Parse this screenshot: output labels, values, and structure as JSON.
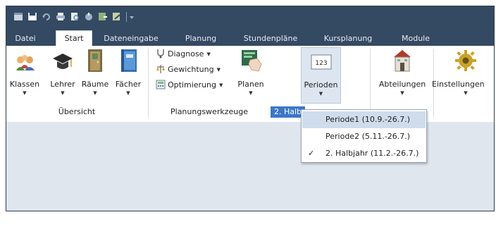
{
  "tabs": [
    {
      "label": "Datei"
    },
    {
      "label": "Start"
    },
    {
      "label": "Dateneingabe"
    },
    {
      "label": "Planung"
    },
    {
      "label": "Stundenpläne"
    },
    {
      "label": "Kursplanung"
    },
    {
      "label": "Module"
    }
  ],
  "ribbon": {
    "uebersicht": {
      "klassen": "Klassen",
      "lehrer": "Lehrer",
      "raeume": "Räume",
      "faecher": "Fächer",
      "group_label": "Übersicht"
    },
    "planungswerkzeuge": {
      "diagnose": "Diagnose",
      "gewichtung": "Gewichtung",
      "optimierung": "Optimierung",
      "planen": "Planen",
      "group_label": "Planungswerkzeuge"
    },
    "perioden": {
      "label": "Perioden",
      "icon_text": "123",
      "group_label": "2. Halb"
    },
    "abteilungen": {
      "label": "Abteilungen"
    },
    "einstellungen": {
      "label": "Einstellungen"
    }
  },
  "perioden_menu": {
    "items": [
      {
        "label": "Periode1 (10.9.-26.7.)",
        "checked": false
      },
      {
        "label": "Periode2 (5.11.-26.7.)",
        "checked": false
      },
      {
        "label": "2. Halbjahr (11.2.-26.7.)",
        "checked": true
      }
    ],
    "check_glyph": "✓"
  },
  "colors": {
    "titlebar": "#344962",
    "selected_group": "#3c78c8",
    "content_bg": "#dfe6ee"
  }
}
